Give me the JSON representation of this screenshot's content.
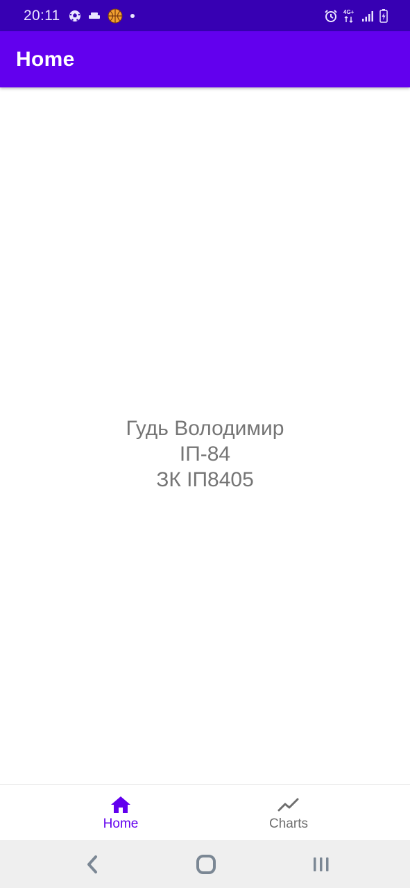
{
  "status_bar": {
    "time": "20:11",
    "network_label": "4G+",
    "left_icons": [
      "soccer-ball-icon",
      "tray-icon",
      "basketball-app-icon",
      "dot-icon"
    ],
    "right_icons": [
      "alarm-icon",
      "network-4g-icon",
      "signal-icon",
      "battery-charging-icon"
    ]
  },
  "app_bar": {
    "title": "Home"
  },
  "main": {
    "lines": [
      "Гудь Володимир",
      "ІП-84",
      "ЗК ІП8405"
    ]
  },
  "bottom_nav": {
    "items": [
      {
        "label": "Home",
        "icon": "home-icon",
        "selected": true
      },
      {
        "label": "Charts",
        "icon": "trending-icon",
        "selected": false
      }
    ]
  },
  "colors": {
    "status_bar": "#3700b3",
    "primary": "#6200ee",
    "text_secondary": "#757575",
    "nav_inactive": "#6e6e6e"
  }
}
